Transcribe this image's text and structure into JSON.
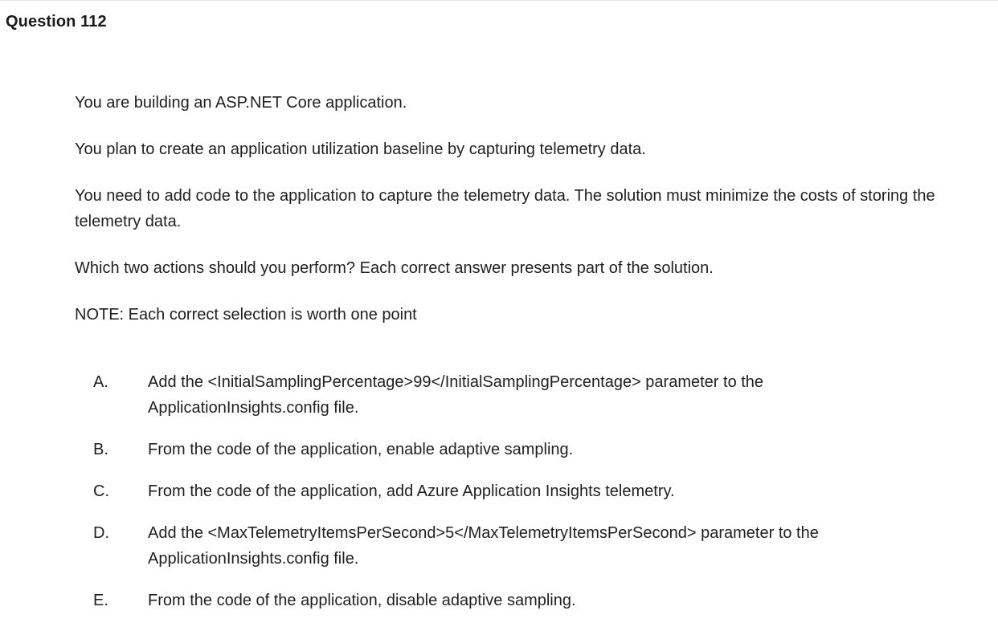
{
  "question": {
    "title": "Question 112"
  },
  "stem": {
    "paragraphs": [
      "You are building an ASP.NET Core application.",
      "You plan to create an application utilization baseline by capturing telemetry data.",
      "You need to add code to the application to capture the telemetry data. The solution must minimize the costs of storing the telemetry data.",
      "Which two actions should you perform? Each correct answer presents part of the solution.",
      "NOTE: Each correct selection is worth one point"
    ]
  },
  "options": [
    {
      "letter": "A.",
      "text": "Add the <InitialSamplingPercentage>99</InitialSamplingPercentage> parameter to the ApplicationInsights.config file."
    },
    {
      "letter": "B.",
      "text": "From the code of the application, enable adaptive sampling."
    },
    {
      "letter": "C.",
      "text": "From the code of the application, add Azure Application Insights telemetry."
    },
    {
      "letter": "D.",
      "text": "Add the <MaxTelemetryItemsPerSecond>5</MaxTelemetryItemsPerSecond> parameter to the ApplicationInsights.config file."
    },
    {
      "letter": "E.",
      "text": "From the code of the application, disable adaptive sampling."
    }
  ]
}
